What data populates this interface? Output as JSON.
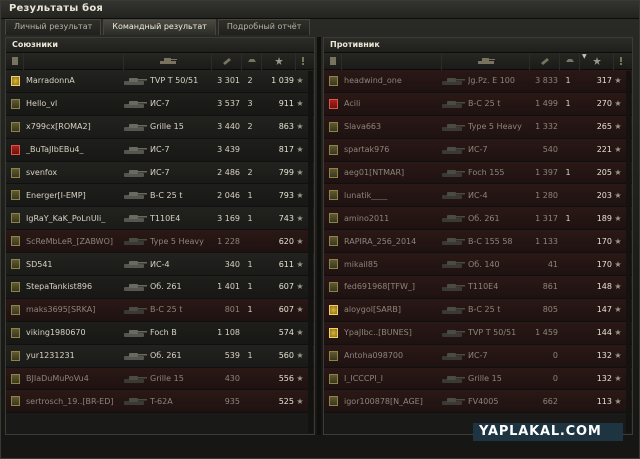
{
  "window": {
    "title": "Результаты боя"
  },
  "tabs": [
    {
      "label": "Личный результат",
      "active": false
    },
    {
      "label": "Командный результат",
      "active": true
    },
    {
      "label": "Подробный отчёт",
      "active": false
    }
  ],
  "allies": {
    "title": "Союзники",
    "rows": [
      {
        "name": "MarradonnA",
        "tank": "TVP T 50/51",
        "dmg": "3 301",
        "frags": "2",
        "xp": "1 039",
        "badge": "gold",
        "destroyed": false
      },
      {
        "name": "Hello_vl",
        "tank": "ИС-7",
        "dmg": "3 537",
        "frags": "3",
        "xp": "911",
        "badge": "",
        "destroyed": false
      },
      {
        "name": "x799cx[ROMA2]",
        "tank": "Grille 15",
        "dmg": "3 440",
        "frags": "2",
        "xp": "863",
        "badge": "",
        "destroyed": false
      },
      {
        "name": "_BuTaJIbEBu4_",
        "tank": "ИС-7",
        "dmg": "3 439",
        "frags": "",
        "xp": "817",
        "badge": "red",
        "destroyed": false
      },
      {
        "name": "svenfox",
        "tank": "ИС-7",
        "dmg": "2 486",
        "frags": "2",
        "xp": "799",
        "badge": "",
        "destroyed": false
      },
      {
        "name": "Energer[I-EMP]",
        "tank": "B-C 25 t",
        "dmg": "2 046",
        "frags": "1",
        "xp": "793",
        "badge": "",
        "destroyed": false
      },
      {
        "name": "IgRaY_KaK_PoLnUIi_",
        "tank": "T110E4",
        "dmg": "3 169",
        "frags": "1",
        "xp": "743",
        "badge": "",
        "destroyed": false
      },
      {
        "name": "ScReMbLeR_[ZABWO]",
        "tank": "Type 5 Heavy",
        "dmg": "1 228",
        "frags": "",
        "xp": "620",
        "badge": "",
        "destroyed": true
      },
      {
        "name": "SD541",
        "tank": "ИС-4",
        "dmg": "340",
        "frags": "1",
        "xp": "611",
        "badge": "",
        "destroyed": false
      },
      {
        "name": "StepaTankist896",
        "tank": "Об. 261",
        "dmg": "1 401",
        "frags": "1",
        "xp": "607",
        "badge": "",
        "destroyed": false
      },
      {
        "name": "maks3695[SRKA]",
        "tank": "B-C 25 t",
        "dmg": "801",
        "frags": "1",
        "xp": "607",
        "badge": "",
        "destroyed": true
      },
      {
        "name": "viking1980670",
        "tank": "Foch B",
        "dmg": "1 108",
        "frags": "",
        "xp": "574",
        "badge": "",
        "destroyed": false
      },
      {
        "name": "yur1231231",
        "tank": "Об. 261",
        "dmg": "539",
        "frags": "1",
        "xp": "560",
        "badge": "",
        "destroyed": false
      },
      {
        "name": "BJIaDuMuPoVu4",
        "tank": "Grille 15",
        "dmg": "430",
        "frags": "",
        "xp": "556",
        "badge": "",
        "destroyed": true
      },
      {
        "name": "sertrosch_19..[BR-ED]",
        "tank": "T-62A",
        "dmg": "935",
        "frags": "",
        "xp": "525",
        "badge": "",
        "destroyed": true
      }
    ]
  },
  "enemies": {
    "title": "Противник",
    "rows": [
      {
        "name": "headwind_one",
        "tank": "Jg.Pz. E 100",
        "dmg": "3 833",
        "frags": "1",
        "xp": "317",
        "badge": "",
        "destroyed": true
      },
      {
        "name": "Acili",
        "tank": "B-C 25 t",
        "dmg": "1 499",
        "frags": "1",
        "xp": "270",
        "badge": "red",
        "destroyed": true
      },
      {
        "name": "Slava663",
        "tank": "Type 5 Heavy",
        "dmg": "1 332",
        "frags": "",
        "xp": "265",
        "badge": "",
        "destroyed": true
      },
      {
        "name": "spartak976",
        "tank": "ИС-7",
        "dmg": "540",
        "frags": "",
        "xp": "221",
        "badge": "",
        "destroyed": true
      },
      {
        "name": "aeg01[NTMAR]",
        "tank": "Foch 155",
        "dmg": "1 397",
        "frags": "1",
        "xp": "205",
        "badge": "",
        "destroyed": true
      },
      {
        "name": "lunatik____",
        "tank": "ИС-4",
        "dmg": "1 280",
        "frags": "",
        "xp": "203",
        "badge": "",
        "destroyed": true
      },
      {
        "name": "amino2011",
        "tank": "Об. 261",
        "dmg": "1 317",
        "frags": "1",
        "xp": "189",
        "badge": "",
        "destroyed": true
      },
      {
        "name": "RAPIRA_256_2014",
        "tank": "B-C 155 58",
        "dmg": "1 133",
        "frags": "",
        "xp": "170",
        "badge": "",
        "destroyed": true
      },
      {
        "name": "mikail85",
        "tank": "Об. 140",
        "dmg": "41",
        "frags": "",
        "xp": "170",
        "badge": "",
        "destroyed": true
      },
      {
        "name": "fed691968[TFW_]",
        "tank": "T110E4",
        "dmg": "861",
        "frags": "",
        "xp": "148",
        "badge": "",
        "destroyed": true
      },
      {
        "name": "aloygol[SARB]",
        "tank": "B-C 25 t",
        "dmg": "805",
        "frags": "",
        "xp": "147",
        "badge": "gold",
        "destroyed": true
      },
      {
        "name": "YpaJIbc..[BUNES]",
        "tank": "TVP T 50/51",
        "dmg": "1 459",
        "frags": "",
        "xp": "144",
        "badge": "gold",
        "destroyed": true
      },
      {
        "name": "Antoha098700",
        "tank": "ИС-7",
        "dmg": "0",
        "frags": "",
        "xp": "132",
        "badge": "",
        "destroyed": true
      },
      {
        "name": "I_ICCCPI_I",
        "tank": "Grille 15",
        "dmg": "0",
        "frags": "",
        "xp": "132",
        "badge": "",
        "destroyed": true
      },
      {
        "name": "igor100878[N_AGE]",
        "tank": "FV4005",
        "dmg": "662",
        "frags": "",
        "xp": "113",
        "badge": "",
        "destroyed": true
      }
    ]
  },
  "watermark": "YAPLAKAL.COM",
  "colors": {
    "accent": "#c9c6b8",
    "destroyed_row": "#2a1816",
    "badge_red": "#b0201a",
    "badge_gold": "#d9b437"
  },
  "icons": [
    "rank-icon",
    "tank-icon",
    "damage-icon",
    "frags-icon",
    "xp-icon",
    "star-icon",
    "platoon-icon"
  ]
}
